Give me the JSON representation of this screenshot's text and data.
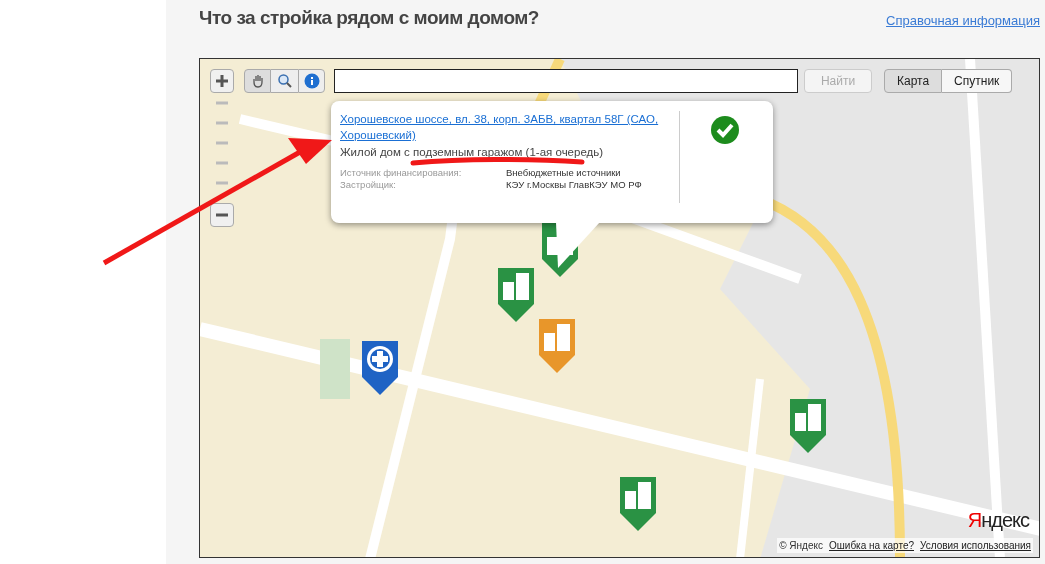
{
  "header": {
    "title": "Что за стройка рядом с моим домом?",
    "help_link": "Справочная информация"
  },
  "map": {
    "search_button": {
      "label": "Найти",
      "disabled": true
    },
    "layers": [
      {
        "label": "Карта",
        "selected": true
      },
      {
        "label": "Спутник",
        "selected": false
      }
    ],
    "popup": {
      "address": "Хорошевское шоссе, вл. 38, корп. 3АБВ, квартал 58Г (САО, Хорошевский)",
      "title": "Жилой дом с подземным гаражом (1-ая очередь)",
      "details": [
        {
          "label": "Источник финансирования:",
          "value": "Внебюджетные источники"
        },
        {
          "label": "Застройщик:",
          "value": "КЭУ г.Москвы ГлавКЭУ МО РФ"
        }
      ]
    },
    "markers": [
      {
        "kind": "building",
        "color": "#2a9244"
      },
      {
        "kind": "building",
        "color": "#2a9244"
      },
      {
        "kind": "building",
        "color": "#e8962a"
      },
      {
        "kind": "medical",
        "color": "#1f63c4"
      },
      {
        "kind": "building",
        "color": "#2a9244"
      },
      {
        "kind": "building",
        "color": "#2a9244"
      }
    ],
    "logo": "Яндекс",
    "copyright": "© Яндекс",
    "links": [
      "Ошибка на карте?",
      "Условия использования"
    ]
  }
}
